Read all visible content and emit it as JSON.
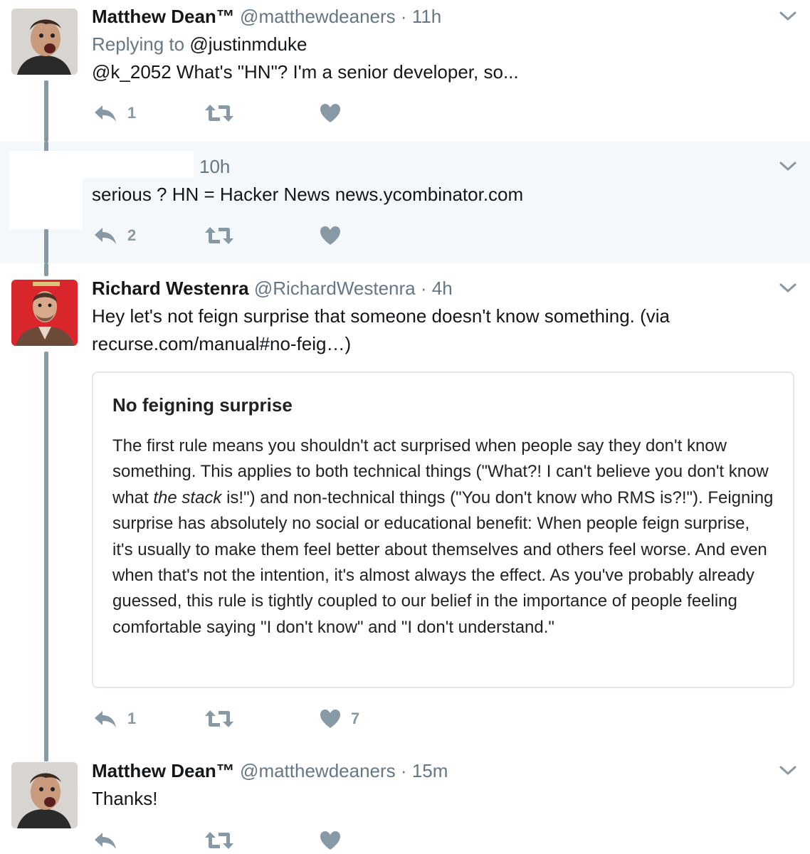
{
  "tweets": [
    {
      "name": "Matthew Dean™",
      "handle": "@matthewdeaners",
      "separator": "·",
      "time": "11h",
      "reply_prefix": "Replying to",
      "reply_target": "@justinmduke",
      "text": "@k_2052 What's \"HN\"? I'm a senior developer, so...",
      "reply_count": "1",
      "retweet_count": "",
      "like_count": ""
    },
    {
      "time": "10h",
      "text": "serious ? HN = Hacker News news.ycombinator.com",
      "reply_count": "2",
      "retweet_count": "",
      "like_count": ""
    },
    {
      "name": "Richard Westenra",
      "handle": "@RichardWestenra",
      "separator": "·",
      "time": "4h",
      "text_line1": "Hey let's not feign surprise that someone doesn't know something. (via",
      "text_line2": "recurse.com/manual#no-feig…)",
      "card": {
        "title": "No feigning surprise",
        "body_before": "The first rule means you shouldn't act surprised when people say they don't know something. This applies to both technical things (\"What?! I can't believe you don't know what ",
        "body_emphasis": "the stack",
        "body_after": " is!\") and non-technical things (\"You don't know who RMS is?!\"). Feigning surprise has absolutely no social or educational benefit: When people feign surprise, it's usually to make them feel better about themselves and others feel worse. And even when that's not the intention, it's almost always the effect. As you've probably already guessed, this rule is tightly coupled to our belief in the importance of people feeling comfortable saying \"I don't know\" and \"I don't understand.\""
      },
      "reply_count": "1",
      "retweet_count": "",
      "like_count": "7"
    },
    {
      "name": "Matthew Dean™",
      "handle": "@matthewdeaners",
      "separator": "·",
      "time": "15m",
      "text": "Thanks!",
      "reply_count": "",
      "retweet_count": "",
      "like_count": ""
    }
  ],
  "icons": {
    "reply": "reply-icon",
    "retweet": "retweet-icon",
    "like": "heart-icon",
    "menu": "chevron-down-icon"
  },
  "colors": {
    "text": "#14171a",
    "secondary": "#657786",
    "action_icon": "#8899a6",
    "highlight_bg": "#f5f8fa",
    "thread_line": "#8899a6"
  }
}
